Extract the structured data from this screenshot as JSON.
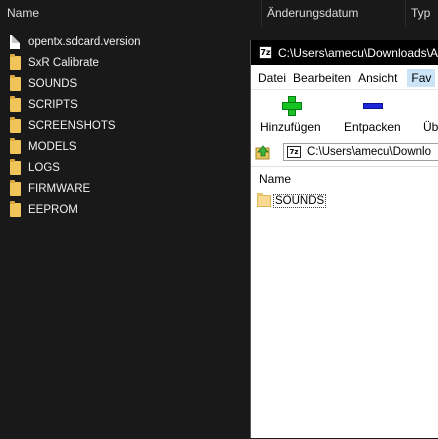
{
  "explorer": {
    "columns": {
      "name": "Name",
      "date": "Änderungsdatum",
      "type": "Typ"
    },
    "items": [
      {
        "label": "opentx.sdcard.version",
        "icon": "file-icon"
      },
      {
        "label": "SxR Calibrate",
        "icon": "folder-icon"
      },
      {
        "label": "SOUNDS",
        "icon": "folder-icon"
      },
      {
        "label": "SCRIPTS",
        "icon": "folder-icon"
      },
      {
        "label": "SCREENSHOTS",
        "icon": "folder-icon"
      },
      {
        "label": "MODELS",
        "icon": "folder-icon"
      },
      {
        "label": "LOGS",
        "icon": "folder-icon"
      },
      {
        "label": "FIRMWARE",
        "icon": "folder-icon"
      },
      {
        "label": "EEPROM",
        "icon": "folder-icon"
      }
    ]
  },
  "zip": {
    "logo_text": "7z",
    "title": "C:\\Users\\amecu\\Downloads\\A",
    "menu": [
      "Datei",
      "Bearbeiten",
      "Ansicht",
      "Fav"
    ],
    "toolbar": {
      "add_label": "Hinzufügen",
      "extract_label": "Entpacken",
      "test_label": "Üb"
    },
    "address": "C:\\Users\\amecu\\Downlo",
    "list": {
      "column_name": "Name",
      "rows": [
        {
          "label": "SOUNDS"
        }
      ]
    }
  },
  "colors": {
    "explorer_bg": "#191919",
    "folder": "#f1c45a",
    "add_green": "#17c324",
    "extract_blue": "#1b27d8",
    "menu_highlight": "#cce4f7"
  }
}
